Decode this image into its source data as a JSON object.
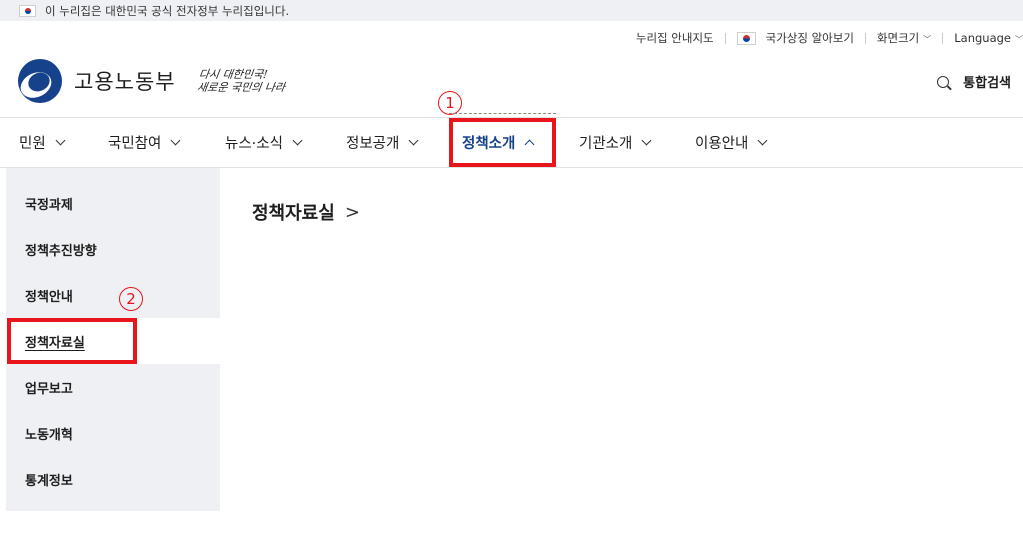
{
  "gov_banner": {
    "text": "이 누리집은 대한민국 공식 전자정부 누리집입니다."
  },
  "utility": {
    "sitemap": "누리집 안내지도",
    "national_symbols": "국가상징 알아보기",
    "screen_size": "화면크기",
    "language": "Language"
  },
  "header": {
    "ministry_name": "고용노동부",
    "slogan_line1": "다시 대한민국!",
    "slogan_line2": "새로운 국민의 나라",
    "search_label": "통합검색"
  },
  "gnb": {
    "items": [
      {
        "label": "민원"
      },
      {
        "label": "국민참여"
      },
      {
        "label": "뉴스·소식"
      },
      {
        "label": "정보공개"
      },
      {
        "label": "정책소개"
      },
      {
        "label": "기관소개"
      },
      {
        "label": "이용안내"
      }
    ],
    "active_index": 4
  },
  "side_menu": {
    "items": [
      {
        "label": "국정과제"
      },
      {
        "label": "정책추진방향"
      },
      {
        "label": "정책안내"
      },
      {
        "label": "정책자료실"
      },
      {
        "label": "업무보고"
      },
      {
        "label": "노동개혁"
      },
      {
        "label": "통계정보"
      }
    ],
    "current_index": 3
  },
  "content": {
    "title": "정책자료실",
    "title_arrow": ">"
  },
  "annotations": {
    "step1": "1",
    "step2": "2"
  },
  "colors": {
    "accent_red": "#e8161a",
    "brand_blue": "#16418b",
    "banner_bg": "#eef0f4"
  },
  "icons": {
    "flag": "korean-flag-icon",
    "search": "search-icon",
    "chevron": "chevron-down-icon"
  }
}
